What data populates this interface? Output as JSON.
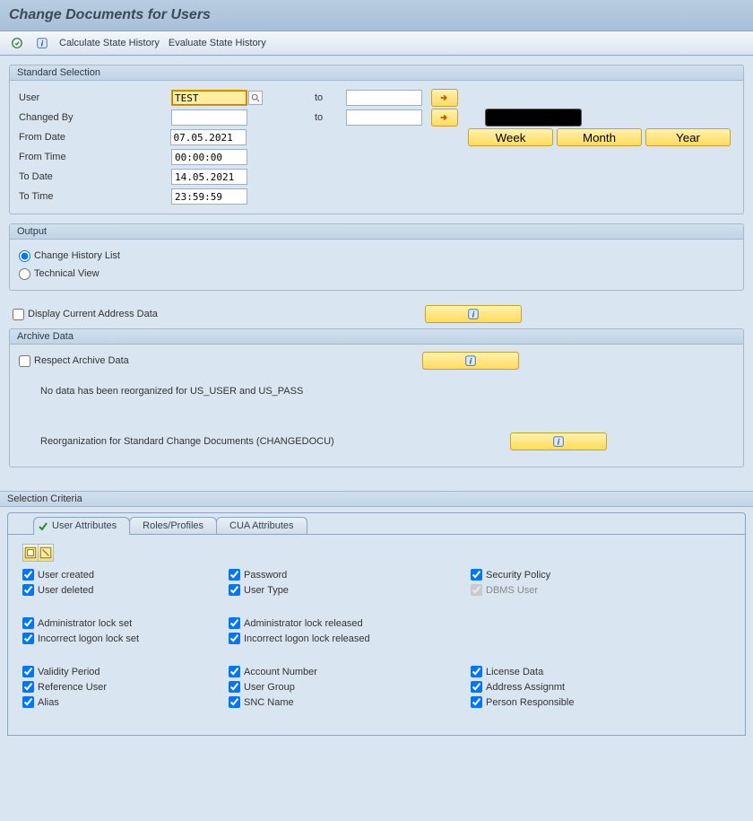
{
  "title": "Change Documents for Users",
  "toolbar": {
    "calc": "Calculate State History",
    "eval": "Evaluate State History"
  },
  "standard": {
    "legend": "Standard Selection",
    "user_label": "User",
    "user_value": "TEST",
    "changedby_label": "Changed By",
    "changedby_value": "",
    "to_label": "to",
    "fromdate_label": "From Date",
    "fromdate_value": "07.05.2021",
    "fromtime_label": "From Time",
    "fromtime_value": "00:00:00",
    "todate_label": "To Date",
    "todate_value": "14.05.2021",
    "totime_label": "To Time",
    "totime_value": "23:59:59",
    "week_btn": "Week",
    "month_btn": "Month",
    "year_btn": "Year"
  },
  "output": {
    "legend": "Output",
    "change_history": "Change History List",
    "technical": "Technical View"
  },
  "display_addr": "Display Current Address Data",
  "archive": {
    "legend": "Archive Data",
    "respect": "Respect Archive Data",
    "msg1": "No data has been reorganized for US_USER and US_PASS",
    "msg2": "Reorganization for Standard Change Documents (CHANGEDOCU)"
  },
  "criteria": {
    "legend": "Selection Criteria",
    "tabs": {
      "ua": "User Attributes",
      "rp": "Roles/Profiles",
      "cua": "CUA Attributes"
    },
    "checks": {
      "user_created": "User created",
      "password": "Password",
      "security_policy": "Security Policy",
      "user_deleted": "User deleted",
      "user_type": "User Type",
      "dbms_user": "DBMS User",
      "admin_lock_set": "Administrator lock set",
      "admin_lock_rel": "Administrator lock released",
      "incorrect_lock_set": "Incorrect logon lock set",
      "incorrect_lock_rel": "Incorrect logon lock released",
      "validity": "Validity Period",
      "account_nr": "Account Number",
      "license": "License Data",
      "ref_user": "Reference User",
      "user_group": "User Group",
      "addr_assign": "Address Assignmt",
      "alias": "Alias",
      "snc": "SNC Name",
      "person_resp": "Person Responsible"
    }
  }
}
